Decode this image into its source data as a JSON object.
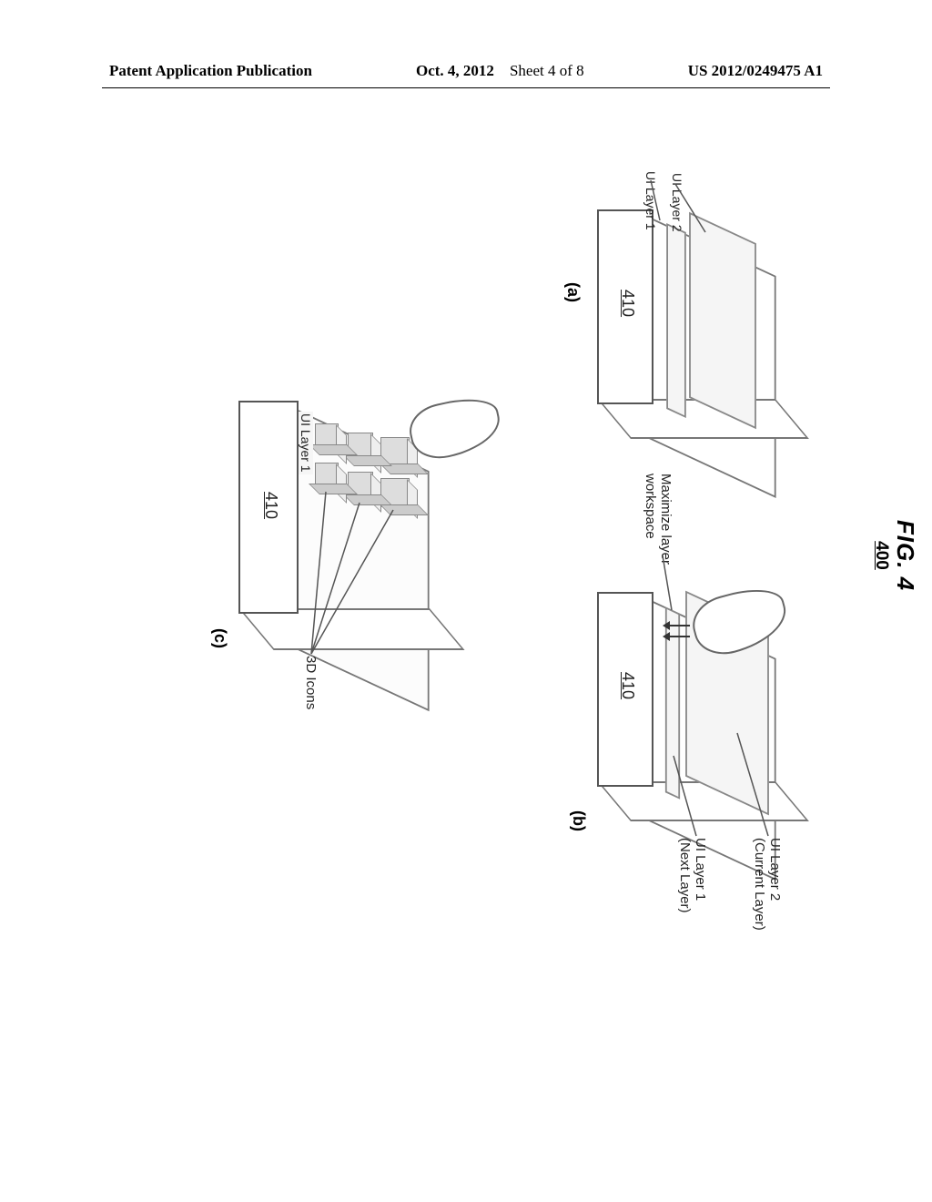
{
  "header": {
    "left": "Patent Application Publication",
    "date": "Oct. 4, 2012",
    "sheet": "Sheet 4 of 8",
    "pubno": "US 2012/0249475 A1"
  },
  "figure": {
    "title_main": "FIG. 4",
    "title_sub": "400",
    "panels": {
      "a": {
        "letter": "(a)",
        "device_ref": "410",
        "layer1": "UI Layer 1",
        "layer2": "UI Layer 2"
      },
      "b": {
        "letter": "(b)",
        "device_ref": "410",
        "current_layer": "UI Layer 2\n(Current Layer)",
        "next_layer": "UI Layer 1\n(Next Layer)",
        "maximize": "Maximize layer\nworkspace"
      },
      "c": {
        "letter": "(c)",
        "device_ref": "410",
        "layer1": "UI Layer 1",
        "icons_label": "3D Icons"
      }
    }
  }
}
